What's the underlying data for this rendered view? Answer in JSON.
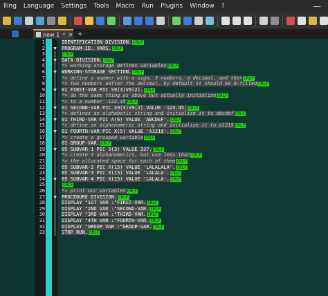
{
  "menu": [
    "lling",
    "Language",
    "Settings",
    "Tools",
    "Macro",
    "Run",
    "Plugins",
    "Window",
    "?"
  ],
  "window_minimize_glyph": "—",
  "tab": {
    "label": "new 1",
    "pin_glyph": "⌗",
    "close_glyph": "✕",
    "add_glyph": "+"
  },
  "eol_marker": "CRLF",
  "toolbar_colors": [
    "#d7b940",
    "#3b7dd8",
    "#cfcfcf",
    "#4aa3df",
    "#8e8e8e",
    "#d7b940",
    "#d45050",
    "#f0c040",
    "#3b7dd8",
    "#6ad06a",
    "#5a98e0",
    "#3b7dd8",
    "#3b7dd8",
    "#cfcfcf",
    "#6ad06a",
    "#3b7dd8",
    "#cfcfcf",
    "#6fc3df",
    "#e0e0e0",
    "#e0e0e0",
    "#e0e0e0",
    "#cfcfcf",
    "#8e8e8e",
    "#d45050",
    "#e0e0e0",
    "#d7b940",
    "#e0e0e0"
  ],
  "lines": [
    {
      "n": "1",
      "fold": "",
      "segs": [
        {
          "t": "IDENTIFICATION DIVISION.",
          "c": false
        }
      ]
    },
    {
      "n": "2",
      "fold": "▼",
      "segs": [
        {
          "t": "PROGRAM-ID. VARS.",
          "c": false
        }
      ]
    },
    {
      "n": "3",
      "fold": "",
      "segs": []
    },
    {
      "n": "4",
      "fold": "▼",
      "segs": [
        {
          "t": "DATA DIVISION.",
          "c": false
        }
      ]
    },
    {
      "n": "5",
      "fold": "",
      "segs": [
        {
          "t": "*> working storage defines variables",
          "c": true
        }
      ]
    },
    {
      "n": "6",
      "fold": "▼",
      "segs": [
        {
          "t": "WORKING-STORAGE SECTION.",
          "c": false
        }
      ]
    },
    {
      "n": "7",
      "fold": "",
      "segs": [
        {
          "t": "*> define a number with a sign, 3 numbers, a decimal, and then",
          "c": true
        }
      ]
    },
    {
      "n": "8",
      "fold": "",
      "segs": [
        {
          "t": "*> two numbers aafter the decimal. by default it should be 0-filled",
          "c": true
        }
      ]
    },
    {
      "n": "9",
      "fold": "▼",
      "segs": [
        {
          "t": "01 FIRST-VAR PIC S9(3)V9(2).",
          "c": false
        }
      ]
    },
    {
      "n": "10",
      "fold": "",
      "segs": [
        {
          "t": "*> do the same thing as above but actually initialize",
          "c": true
        }
      ]
    },
    {
      "n": "11",
      "fold": "",
      "segs": [
        {
          "t": "*> to a number -123.45",
          "c": true
        }
      ]
    },
    {
      "n": "12",
      "fold": "▼",
      "segs": [
        {
          "t": "01 SECOND-VAR PIC S9(3)V9(2) VALUE -123.45.",
          "c": false
        }
      ]
    },
    {
      "n": "13",
      "fold": "",
      "segs": [
        {
          "t": "*> defines an alphabetic string and initialize it to abcdef",
          "c": true
        }
      ]
    },
    {
      "n": "14",
      "fold": "▼",
      "segs": [
        {
          "t": "01 THIRD-VAR PIC A(6) VALUE 'ABCDEF'.",
          "c": false
        }
      ]
    },
    {
      "n": "15",
      "fold": "",
      "segs": [
        {
          "t": "*> define an alphanumeric string and initialize it to a121$",
          "c": true
        }
      ]
    },
    {
      "n": "16",
      "fold": "▼",
      "segs": [
        {
          "t": "01 FOURTH-VAR PIC X(5) VALUE 'A121$'.",
          "c": false
        }
      ]
    },
    {
      "n": "17",
      "fold": "",
      "segs": [
        {
          "t": "*> create a grouped variable",
          "c": true
        }
      ]
    },
    {
      "n": "18",
      "fold": "",
      "segs": [
        {
          "t": "01 GROUP-VAR.",
          "c": false
        }
      ]
    },
    {
      "n": "19",
      "fold": "▼",
      "segs": [
        {
          "t": "05 SUBVAR-1 PIC 9(3) VALUE 337.",
          "c": false
        }
      ]
    },
    {
      "n": "20",
      "fold": "",
      "segs": [
        {
          "t": "*> create 3 alphanumerics, but use less than",
          "c": true
        }
      ]
    },
    {
      "n": "21",
      "fold": "",
      "segs": [
        {
          "t": "*> the allocated space for each of them",
          "c": true
        }
      ]
    },
    {
      "n": "22",
      "fold": "",
      "segs": [
        {
          "t": "05 SUBVAR-2 PIC X(15) VALUE 'LALALALA'.",
          "c": false
        }
      ]
    },
    {
      "n": "23",
      "fold": "",
      "segs": [
        {
          "t": "05 SUBVAR-3 PIC X(15) VALUE 'LALALA'.",
          "c": false
        }
      ]
    },
    {
      "n": "24",
      "fold": "▼",
      "segs": [
        {
          "t": "05 SUBVAR-4 PIC X(15) VALUE 'LALALA'.",
          "c": false
        }
      ]
    },
    {
      "n": "25",
      "fold": "",
      "segs": []
    },
    {
      "n": "26",
      "fold": "",
      "segs": [
        {
          "t": "*> print our variables",
          "c": true
        }
      ]
    },
    {
      "n": "27",
      "fold": "▼",
      "segs": [
        {
          "t": "PROCEDURE DIVISION.",
          "c": false
        }
      ]
    },
    {
      "n": "28",
      "fold": "",
      "segs": [
        {
          "t": "DISPLAY \"1ST VAR :\"FIRST-VAR.",
          "c": false
        }
      ]
    },
    {
      "n": "29",
      "fold": "",
      "segs": [
        {
          "t": "DISPLAY \"2ND VAR :\"SECOND-VAR.",
          "c": false
        }
      ]
    },
    {
      "n": "30",
      "fold": "",
      "segs": [
        {
          "t": "DISPLAY \"3RD VAR :\"THIRD-VAR.",
          "c": false
        }
      ]
    },
    {
      "n": "31",
      "fold": "",
      "segs": [
        {
          "t": "DISPLAY \"4TH VAR :\"FOURTH-VAR.",
          "c": false
        }
      ]
    },
    {
      "n": "32",
      "fold": "",
      "segs": [
        {
          "t": "DISPLAY \"GROUP VAR :\"GROUP-VAR.",
          "c": false
        }
      ]
    },
    {
      "n": "33",
      "fold": "",
      "segs": [
        {
          "t": "STOP RUN.",
          "c": false
        }
      ]
    }
  ]
}
